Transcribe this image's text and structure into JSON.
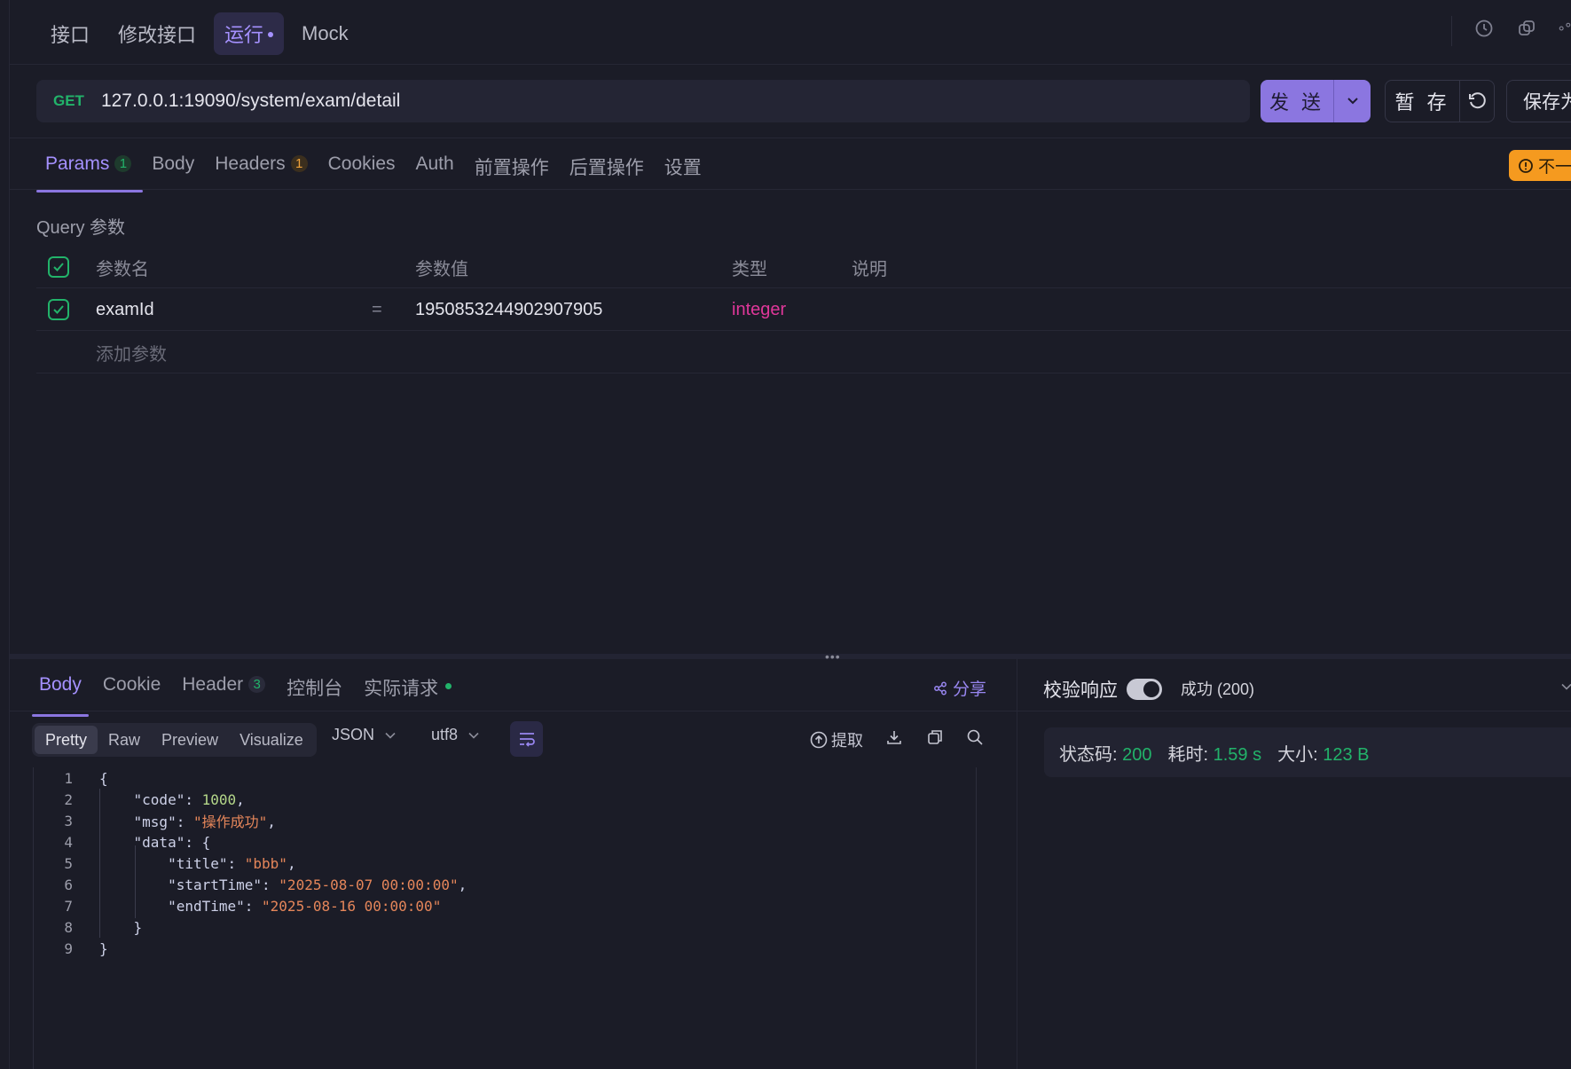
{
  "top_tabs": [
    {
      "label": "接口"
    },
    {
      "label": "修改接口"
    },
    {
      "label": "运行"
    },
    {
      "label": "Mock"
    }
  ],
  "request": {
    "method": "GET",
    "url": "127.0.0.1:19090/system/exam/detail",
    "send_label": "发 送",
    "save_label": "暂 存",
    "save_as_label": "保存为"
  },
  "req_tabs": [
    {
      "label": "Params",
      "badge": "1"
    },
    {
      "label": "Body"
    },
    {
      "label": "Headers",
      "badge": "1"
    },
    {
      "label": "Cookies"
    },
    {
      "label": "Auth"
    },
    {
      "label": "前置操作"
    },
    {
      "label": "后置操作"
    },
    {
      "label": "设置"
    }
  ],
  "warn_tag": "不一",
  "query_section_title": "Query 参数",
  "params_table": {
    "headers": {
      "name": "参数名",
      "value": "参数值",
      "type": "类型",
      "desc": "说明"
    },
    "rows": [
      {
        "name": "examId",
        "eq": "=",
        "value": "1950853244902907905",
        "type": "integer",
        "desc": ""
      }
    ],
    "add_placeholder": "添加参数"
  },
  "resp_tabs": [
    {
      "label": "Body"
    },
    {
      "label": "Cookie"
    },
    {
      "label": "Header",
      "badge": "3"
    },
    {
      "label": "控制台"
    },
    {
      "label": "实际请求"
    }
  ],
  "share_label": "分享",
  "view_modes": [
    "Pretty",
    "Raw",
    "Preview",
    "Visualize"
  ],
  "format_select": "JSON",
  "encoding_select": "utf8",
  "extract_label": "提取",
  "code_lines": [
    {
      "n": "1"
    },
    {
      "n": "2"
    },
    {
      "n": "3"
    },
    {
      "n": "4"
    },
    {
      "n": "5"
    },
    {
      "n": "6"
    },
    {
      "n": "7"
    },
    {
      "n": "8"
    },
    {
      "n": "9"
    }
  ],
  "json_body": {
    "code_key": "\"code\"",
    "code_val": "1000",
    "msg_key": "\"msg\"",
    "msg_val": "\"操作成功\"",
    "data_key": "\"data\"",
    "title_key": "\"title\"",
    "title_val": "\"bbb\"",
    "start_key": "\"startTime\"",
    "start_val": "\"2025-08-07 00:00:00\"",
    "end_key": "\"endTime\"",
    "end_val": "\"2025-08-16 00:00:00\""
  },
  "validate": {
    "label": "校验响应",
    "result": "成功 (200)"
  },
  "status": {
    "code_label": "状态码:",
    "code_value": "200",
    "time_label": "耗时:",
    "time_value": "1.59 s",
    "size_label": "大小:",
    "size_value": "123 B"
  },
  "colors": {
    "accent": "#8b76e0",
    "success": "#22b36a",
    "type_color": "#e0379a",
    "warning": "#f59a1f"
  }
}
